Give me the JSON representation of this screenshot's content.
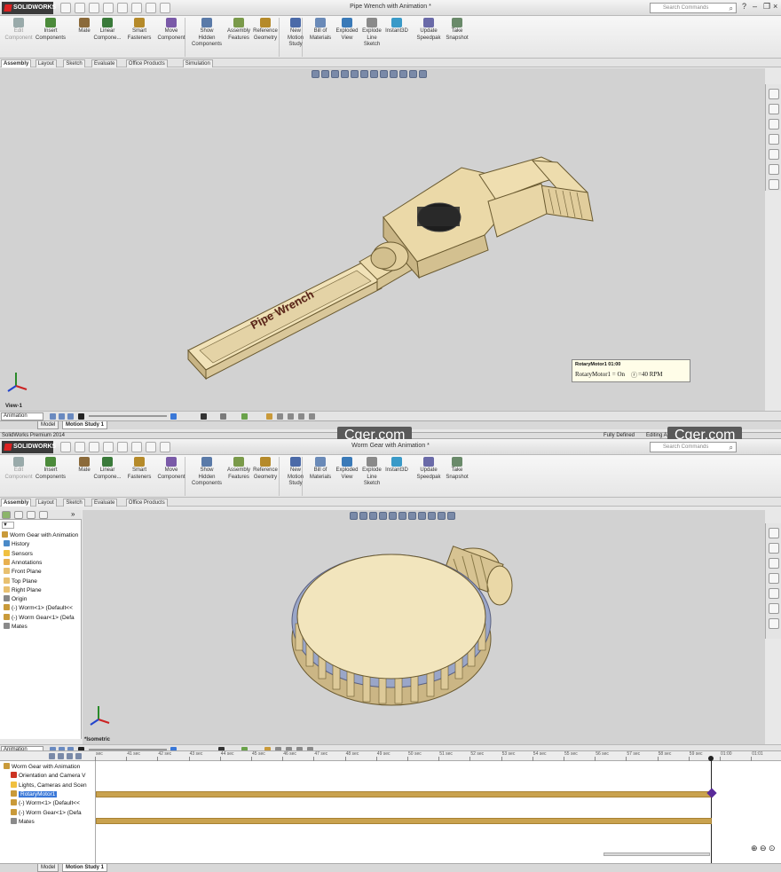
{
  "window1": {
    "logo": "SOLIDWORKS",
    "doc_title": "Pipe Wrench with Animation *",
    "search_placeholder": "Search Commands",
    "ribbon": [
      {
        "l1": "Edit",
        "l2": "Component",
        "dis": true
      },
      {
        "l1": "Insert",
        "l2": "Components"
      },
      {
        "l1": "Mate",
        "l2": ""
      },
      {
        "l1": "Linear",
        "l2": "Compone..."
      },
      {
        "l1": "Smart",
        "l2": "Fasteners"
      },
      {
        "l1": "Move",
        "l2": "Component"
      },
      {
        "l1": "Show",
        "l2": "Hidden",
        "l3": "Components"
      },
      {
        "l1": "Assembly",
        "l2": "Features"
      },
      {
        "l1": "Reference",
        "l2": "Geometry"
      },
      {
        "l1": "New",
        "l2": "Motion",
        "l3": "Study"
      },
      {
        "l1": "Bill of",
        "l2": "Materials"
      },
      {
        "l1": "Exploded",
        "l2": "View"
      },
      {
        "l1": "Explode",
        "l2": "Line",
        "l3": "Sketch"
      },
      {
        "l1": "Instant3D",
        "l2": ""
      },
      {
        "l1": "Update",
        "l2": "Speedpak"
      },
      {
        "l1": "Take",
        "l2": "Snapshot"
      }
    ],
    "tabs": [
      "Assembly",
      "Layout",
      "Sketch",
      "Evaluate",
      "Office Products",
      "Simulation"
    ],
    "model_text": "Pipe Wrench",
    "view_label": "View-1",
    "study_type": "Animation",
    "bottom_tabs": [
      "Model",
      "Motion Study 1"
    ]
  },
  "status": {
    "app": "SolidWorks Premium 2014",
    "state": "Fully Defined",
    "mode": "Editing Assembly"
  },
  "watermark": "Cger.com",
  "window2": {
    "logo": "SOLIDWORKS",
    "doc_title": "Worm Gear with Animation *",
    "search_placeholder": "Search Commands",
    "ribbon": [
      {
        "l1": "Edit",
        "l2": "Component",
        "dis": true
      },
      {
        "l1": "Insert",
        "l2": "Components"
      },
      {
        "l1": "Mate",
        "l2": ""
      },
      {
        "l1": "Linear",
        "l2": "Compone..."
      },
      {
        "l1": "Smart",
        "l2": "Fasteners"
      },
      {
        "l1": "Move",
        "l2": "Component"
      },
      {
        "l1": "Show",
        "l2": "Hidden",
        "l3": "Components"
      },
      {
        "l1": "Assembly",
        "l2": "Features"
      },
      {
        "l1": "Reference",
        "l2": "Geometry"
      },
      {
        "l1": "New",
        "l2": "Motion",
        "l3": "Study"
      },
      {
        "l1": "Bill of",
        "l2": "Materials"
      },
      {
        "l1": "Exploded",
        "l2": "View"
      },
      {
        "l1": "Explode",
        "l2": "Line",
        "l3": "Sketch"
      },
      {
        "l1": "Instant3D",
        "l2": ""
      },
      {
        "l1": "Update",
        "l2": "Speedpak"
      },
      {
        "l1": "Take",
        "l2": "Snapshot"
      }
    ],
    "tabs": [
      "Assembly",
      "Layout",
      "Sketch",
      "Evaluate",
      "Office Products"
    ],
    "tree": [
      "Worm Gear with Animation",
      "History",
      "Sensors",
      "Annotations",
      "Front Plane",
      "Top Plane",
      "Right Plane",
      "Origin",
      "(-) Worm<1> (Default<<",
      "(-) Worm Gear<1> (Defa",
      "Mates"
    ],
    "view_label": "*Isometric",
    "study_type": "Animation",
    "ruler": [
      "sec",
      "41 sec",
      "42 sec",
      "43 sec",
      "44 sec",
      "45 sec",
      "46 sec",
      "47 sec",
      "48 sec",
      "49 sec",
      "50 sec",
      "51 sec",
      "52 sec",
      "53 sec",
      "54 sec",
      "55 sec",
      "56 sec",
      "57 sec",
      "58 sec",
      "59 sec",
      "01:00",
      "01:01",
      "01:02"
    ],
    "timeline_tree": [
      "Worm Gear with Animation",
      "Orientation and Camera V",
      "Lights, Cameras and Scen",
      "RotaryMotor1",
      "(-) Worm<1> (Default<<",
      "(-) Worm Gear<1> (Defa",
      "Mates"
    ],
    "tooltip_title": "RotaryMotor1 01:00",
    "tooltip_text": "RotaryMotor1 = On",
    "tooltip_rpm": "=40 RPM",
    "bottom_tabs": [
      "Model",
      "Motion Study 1"
    ]
  }
}
